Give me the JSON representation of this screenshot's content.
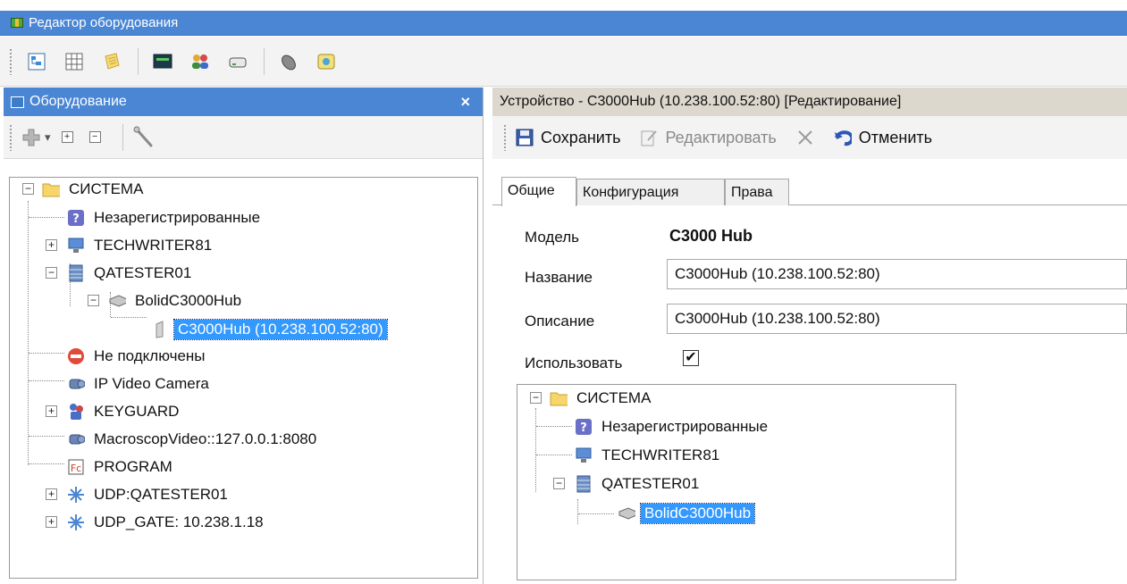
{
  "window": {
    "title": "Редактор оборудования"
  },
  "toolbar": {
    "icons": [
      "tree-view-icon",
      "table-icon",
      "notes-icon",
      "monitor-icon",
      "users-icon",
      "drive-icon",
      "mouse-icon",
      "map-icon"
    ]
  },
  "left_panel": {
    "title": "Оборудование",
    "close_label": "×",
    "toolbar": {
      "add_dropdown": "▾",
      "expand": "+",
      "collapse": "−"
    },
    "tree": [
      {
        "label": "СИСТЕМА",
        "icon": "folder-icon"
      },
      {
        "label": "Незарегистрированные",
        "icon": "question-icon"
      },
      {
        "label": "TECHWRITER81",
        "icon": "computer-icon"
      },
      {
        "label": "QATESTER01",
        "icon": "server-icon"
      },
      {
        "label": "BolidC3000Hub",
        "icon": "hub-icon"
      },
      {
        "label": "C3000Hub (10.238.100.52:80)",
        "icon": "device-icon",
        "selected": true
      },
      {
        "label": "Не подключены",
        "icon": "stop-icon"
      },
      {
        "label": "IP Video Camera",
        "icon": "camera-icon"
      },
      {
        "label": "KEYGUARD",
        "icon": "keyguard-icon"
      },
      {
        "label": "MacroscopVideo::127.0.0.1:8080",
        "icon": "camera-icon"
      },
      {
        "label": "PROGRAM",
        "icon": "program-icon"
      },
      {
        "label": "UDP:QATESTER01",
        "icon": "network-icon"
      },
      {
        "label": "UDP_GATE: 10.238.1.18",
        "icon": "network-icon"
      }
    ]
  },
  "right_panel": {
    "title": "Устройство - C3000Hub (10.238.100.52:80) [Редактирование]",
    "actions": {
      "save": "Сохранить",
      "edit": "Редактировать",
      "cancel": "Отменить"
    },
    "tabs": [
      "Общие",
      "Конфигурация",
      "Права"
    ],
    "active_tab": "Общие",
    "form": {
      "model_label": "Модель",
      "model_value": "C3000 Hub",
      "name_label": "Название",
      "name_value": "C3000Hub (10.238.100.52:80)",
      "desc_label": "Описание",
      "desc_value": "C3000Hub (10.238.100.52:80)",
      "use_label": "Использовать",
      "use_checked": "✔"
    },
    "tree": [
      {
        "label": "СИСТЕМА",
        "icon": "folder-icon"
      },
      {
        "label": "Незарегистрированные",
        "icon": "question-icon"
      },
      {
        "label": "TECHWRITER81",
        "icon": "computer-icon"
      },
      {
        "label": "QATESTER01",
        "icon": "server-icon"
      },
      {
        "label": "BolidC3000Hub",
        "icon": "hub-icon",
        "selected": true
      }
    ]
  },
  "colors": {
    "title_bar": "#4a86d4",
    "selection": "#3399ff",
    "right_header": "#dcd8cd"
  }
}
